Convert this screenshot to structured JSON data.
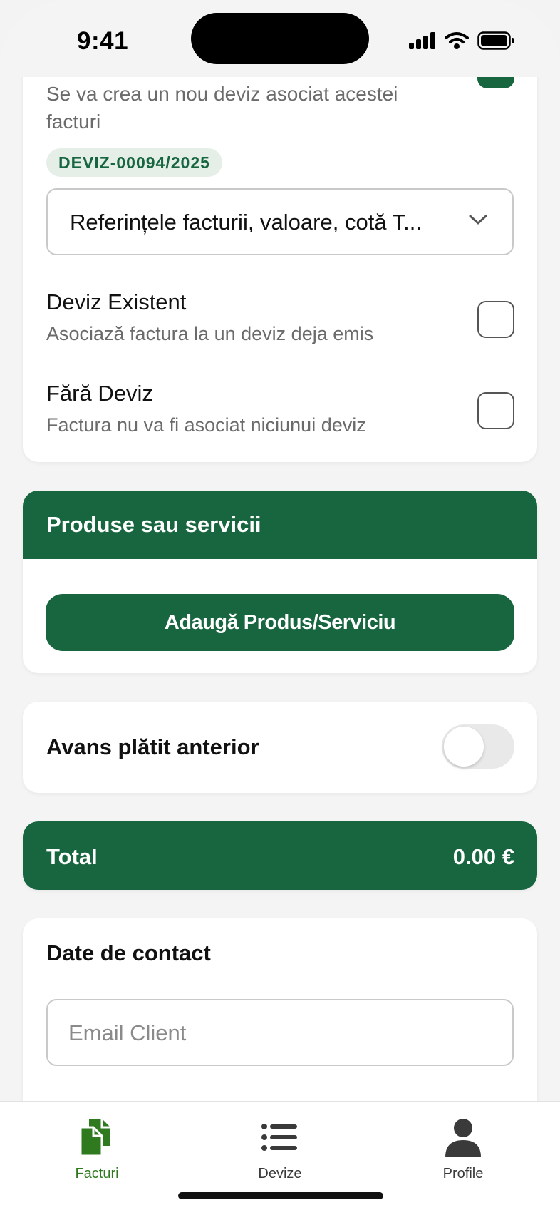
{
  "status_bar": {
    "time": "9:41"
  },
  "deviz_nou": {
    "description": "Se va crea un nou deviz asociat acestei facturi",
    "badge": "DEVIZ-00094/2025",
    "select_value": "Referințele facturii, valoare, cotă T..."
  },
  "options": [
    {
      "title": "Deviz Existent",
      "subtitle": "Asociază factura la un deviz deja emis"
    },
    {
      "title": "Fără Deviz",
      "subtitle": "Factura nu va fi asociat niciunui deviz"
    }
  ],
  "products": {
    "title": "Produse sau servicii",
    "add_button": "Adaugă Produs/Serviciu"
  },
  "avans": {
    "label": "Avans plătit anterior",
    "enabled": false
  },
  "total": {
    "label": "Total",
    "value": "0.00 €"
  },
  "contact": {
    "title": "Date de contact",
    "email_placeholder": "Email Client"
  },
  "tabs": [
    {
      "label": "Facturi",
      "icon": "documents-icon",
      "active": true
    },
    {
      "label": "Devize",
      "icon": "list-icon",
      "active": false
    },
    {
      "label": "Profile",
      "icon": "person-icon",
      "active": false
    }
  ],
  "colors": {
    "brand_green": "#176640",
    "active_tab": "#2f7a1f",
    "inactive_tab": "#3a3a3a"
  }
}
